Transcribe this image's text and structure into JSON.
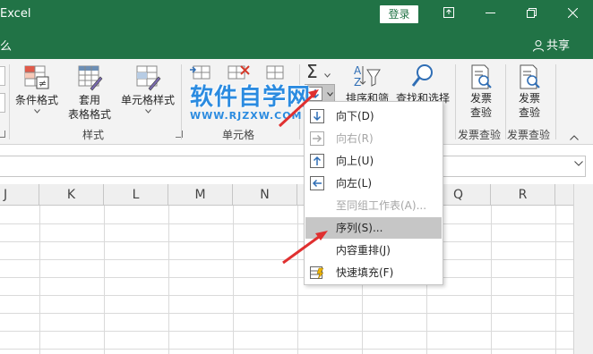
{
  "titlebar": {
    "app_title": "Excel",
    "login_label": "登录",
    "ribbon_display_icon": "ribbon-display-icon",
    "minimize_icon": "minimize-icon",
    "restore_icon": "restore-icon",
    "close_icon": "close-icon"
  },
  "tellbar": {
    "tell_text": "么",
    "share_label": "共享"
  },
  "ribbon": {
    "conditional_format_label": "条件格式",
    "table_format_line1": "套用",
    "table_format_line2": "表格格式",
    "cell_styles_label": "单元格样式",
    "styles_group_label": "样式",
    "cells_group_label": "单元格",
    "sort_filter_label": "排序和筛选",
    "find_select_label": "查找和选择",
    "invoice_check_1_line1": "发票",
    "invoice_check_1_line2": "查验",
    "invoice_check_2_line1": "发票",
    "invoice_check_2_line2": "查验",
    "invoice_group_1_label": "发票查验",
    "invoice_group_2_label": "发票查验"
  },
  "watermark": {
    "title": "软件自学网",
    "url": "WWW.RJZXW.COM"
  },
  "columns": [
    "J",
    "K",
    "L",
    "M",
    "N",
    "O",
    "P",
    "Q",
    "R"
  ],
  "fill_menu": {
    "items": [
      {
        "label": "向下(D)",
        "icon": "fill-down-icon",
        "enabled": true
      },
      {
        "label": "向右(R)",
        "icon": "fill-right-icon",
        "enabled": false
      },
      {
        "label": "向上(U)",
        "icon": "fill-up-icon",
        "enabled": true
      },
      {
        "label": "向左(L)",
        "icon": "fill-left-icon",
        "enabled": true
      },
      {
        "label": "至同组工作表(A)...",
        "icon": "",
        "enabled": false
      },
      {
        "label": "序列(S)...",
        "icon": "",
        "enabled": true,
        "highlighted": true
      },
      {
        "label": "内容重排(J)",
        "icon": "",
        "enabled": true
      },
      {
        "label": "快速填充(F)",
        "icon": "flash-fill-icon",
        "enabled": true
      }
    ]
  },
  "colors": {
    "excel_green": "#217346",
    "highlight": "#c6c6c6",
    "annotation_red": "#e03030",
    "watermark_blue": "#2b8be0"
  }
}
